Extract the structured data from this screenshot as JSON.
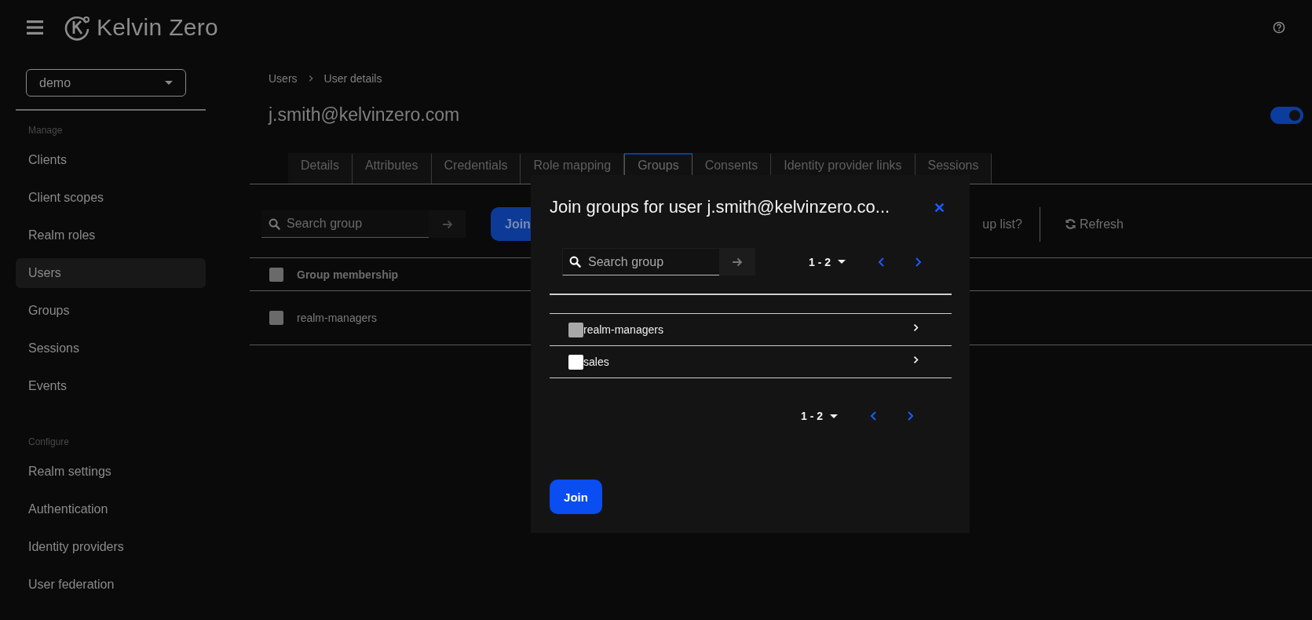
{
  "header": {
    "brand": "Kelvin Zero"
  },
  "sidebar": {
    "realm": "demo",
    "sections": [
      {
        "heading": "Manage",
        "items": [
          {
            "label": "Clients",
            "selected": false
          },
          {
            "label": "Client scopes",
            "selected": false
          },
          {
            "label": "Realm roles",
            "selected": false
          },
          {
            "label": "Users",
            "selected": true
          },
          {
            "label": "Groups",
            "selected": false
          },
          {
            "label": "Sessions",
            "selected": false
          },
          {
            "label": "Events",
            "selected": false
          }
        ]
      },
      {
        "heading": "Configure",
        "items": [
          {
            "label": "Realm settings",
            "selected": false
          },
          {
            "label": "Authentication",
            "selected": false
          },
          {
            "label": "Identity providers",
            "selected": false
          },
          {
            "label": "User federation",
            "selected": false
          }
        ]
      }
    ]
  },
  "breadcrumb": [
    "Users",
    "User details"
  ],
  "title": "j.smith@kelvinzero.com",
  "enabled_toggle": {
    "on": true
  },
  "tabs": [
    {
      "label": "Details",
      "selected": false
    },
    {
      "label": "Attributes",
      "selected": false
    },
    {
      "label": "Credentials",
      "selected": false
    },
    {
      "label": "Role mapping",
      "selected": false
    },
    {
      "label": "Groups",
      "selected": true
    },
    {
      "label": "Consents",
      "selected": false
    },
    {
      "label": "Identity provider links",
      "selected": false
    },
    {
      "label": "Sessions",
      "selected": false
    }
  ],
  "toolbar": {
    "search": {
      "placeholder": "Search group"
    },
    "join_button": "Join",
    "partial_label": "up list?",
    "refresh_button": "Refresh"
  },
  "table": {
    "columns": [
      {
        "label": "Group membership",
        "checked": false
      }
    ],
    "rows": [
      {
        "name": "realm-managers",
        "checked": false
      }
    ]
  },
  "dialog": {
    "title": "Join groups for user j.smith@kelvinzero.co...",
    "search": {
      "placeholder": "Search group"
    },
    "pagination_top": {
      "range": "1 - 2"
    },
    "rows": [
      {
        "name": "realm-managers",
        "disabled": true
      },
      {
        "name": "sales",
        "disabled": false
      }
    ],
    "pagination_bottom": {
      "range": "1 - 2"
    },
    "join_button": "Join"
  }
}
